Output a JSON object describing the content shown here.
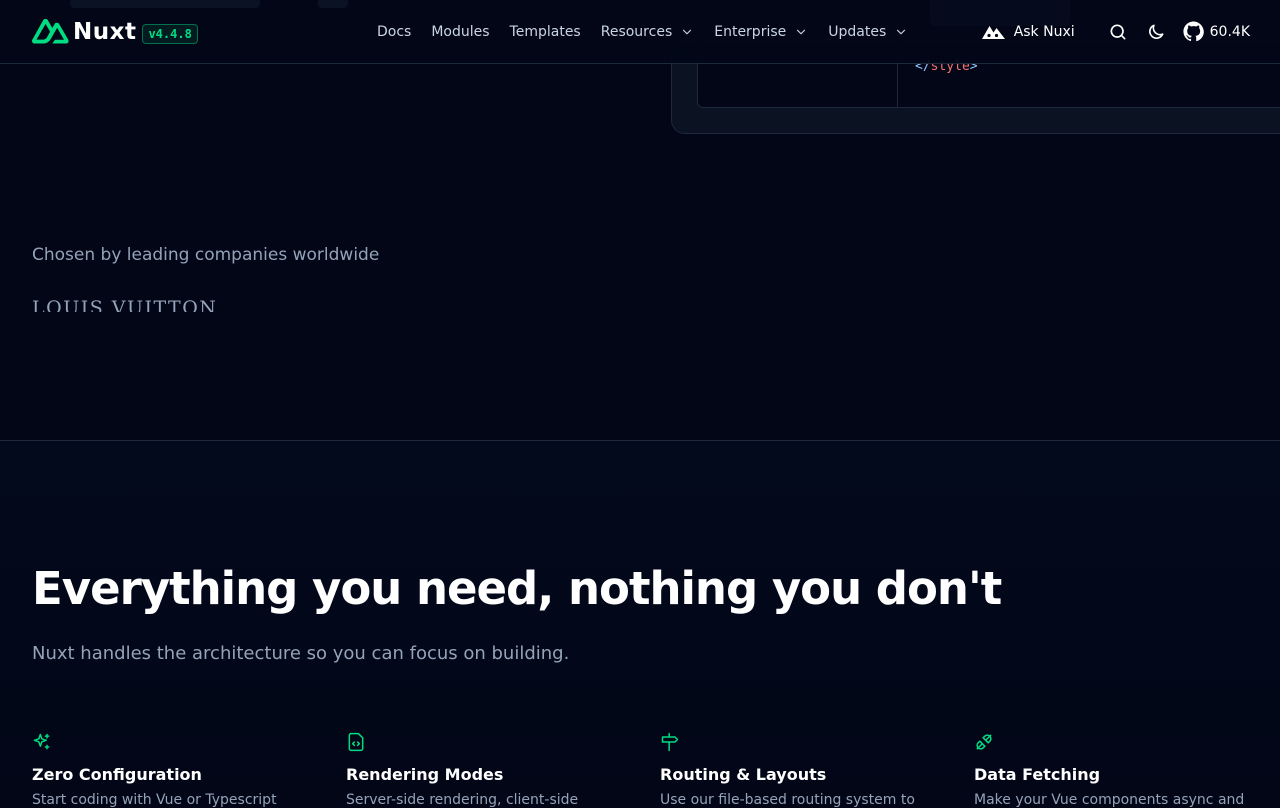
{
  "brand": {
    "name": "Nuxt",
    "version": "v4.4.8",
    "accent": "#00dc82",
    "logo_icon": "nuxt-logo-icon"
  },
  "nav": {
    "items": [
      {
        "label": "Docs",
        "has_dropdown": false
      },
      {
        "label": "Modules",
        "has_dropdown": false
      },
      {
        "label": "Templates",
        "has_dropdown": false
      },
      {
        "label": "Resources",
        "has_dropdown": true
      },
      {
        "label": "Enterprise",
        "has_dropdown": true
      },
      {
        "label": "Updates",
        "has_dropdown": true
      }
    ]
  },
  "tools": {
    "ask_label": "Ask Nuxi",
    "ask_icon": "nuxi-mountain-icon",
    "search_icon": "search-icon",
    "theme_icon": "moon-icon",
    "github_icon": "github-icon",
    "github_stars": "60.4K"
  },
  "code": {
    "open_bracket": "</",
    "tag": "style",
    "close_bracket": ">"
  },
  "companies": {
    "title": "Chosen by leading companies worldwide",
    "first_logo": "LOUIS VUITTON"
  },
  "features": {
    "title": "Everything you need, nothing you don't",
    "subtitle": "Nuxt handles the architecture so you can focus on building.",
    "items": [
      {
        "icon": "sparkles-icon",
        "title": "Zero Configuration",
        "desc": "Start coding with Vue or Typescript"
      },
      {
        "icon": "file-code-icon",
        "title": "Rendering Modes",
        "desc": "Server-side rendering, client-side"
      },
      {
        "icon": "signpost-icon",
        "title": "Routing & Layouts",
        "desc": "Use our file-based routing system to"
      },
      {
        "icon": "plug-icon",
        "title": "Data Fetching",
        "desc": "Make your Vue components async and"
      }
    ]
  }
}
